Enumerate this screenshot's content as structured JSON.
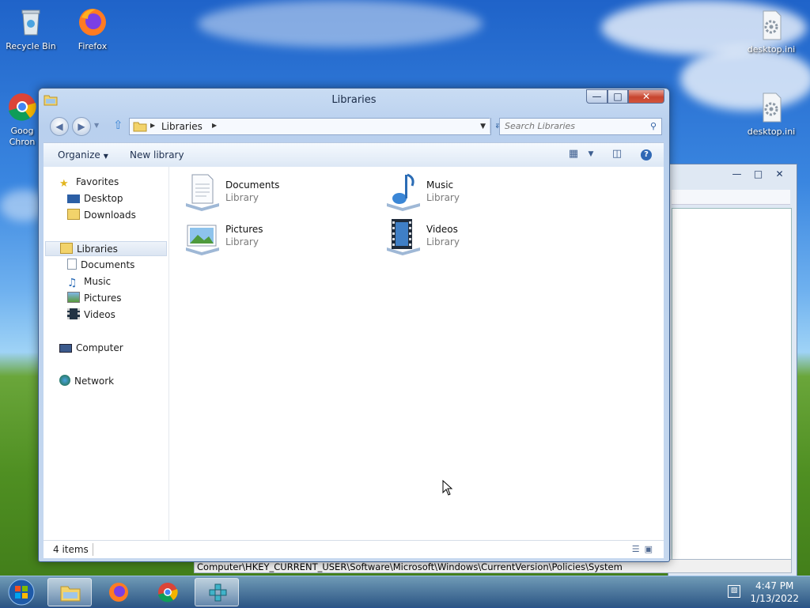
{
  "desktop": {
    "icons": [
      {
        "label": "Recycle Bin",
        "icon": "recycle-bin-icon"
      },
      {
        "label": "Firefox",
        "icon": "firefox-icon"
      },
      {
        "label": "Goog\nChron",
        "icon": "chrome-icon"
      },
      {
        "label": "desktop.ini",
        "icon": "settings-file-icon"
      },
      {
        "label": "desktop.ini",
        "icon": "settings-file-icon"
      }
    ]
  },
  "background_window": {
    "status_path": "Computer\\HKEY_CURRENT_USER\\Software\\Microsoft\\Windows\\CurrentVersion\\Policies\\System"
  },
  "explorer": {
    "title": "Libraries",
    "controls": {
      "minimize": "—",
      "maximize": "□",
      "close": "✕"
    },
    "address": {
      "crumb": "Libraries"
    },
    "search": {
      "placeholder": "Search Libraries"
    },
    "toolbar": {
      "organize": "Organize",
      "new_library": "New library"
    },
    "nav": {
      "favorites": "Favorites",
      "desktop": "Desktop",
      "downloads": "Downloads",
      "libraries": "Libraries",
      "documents": "Documents",
      "music": "Music",
      "pictures": "Pictures",
      "videos": "Videos",
      "computer": "Computer",
      "network": "Network"
    },
    "libraries": [
      {
        "name": "Documents",
        "type": "Library",
        "icon": "documents-library-icon"
      },
      {
        "name": "Music",
        "type": "Library",
        "icon": "music-library-icon"
      },
      {
        "name": "Pictures",
        "type": "Library",
        "icon": "pictures-library-icon"
      },
      {
        "name": "Videos",
        "type": "Library",
        "icon": "videos-library-icon"
      }
    ],
    "status": {
      "count": "4 items"
    }
  },
  "taskbar": {
    "items": [
      "start-orb",
      "explorer",
      "firefox",
      "chrome",
      "regedit"
    ],
    "clock": {
      "time": "4:47 PM",
      "date": "1/13/2022"
    }
  }
}
